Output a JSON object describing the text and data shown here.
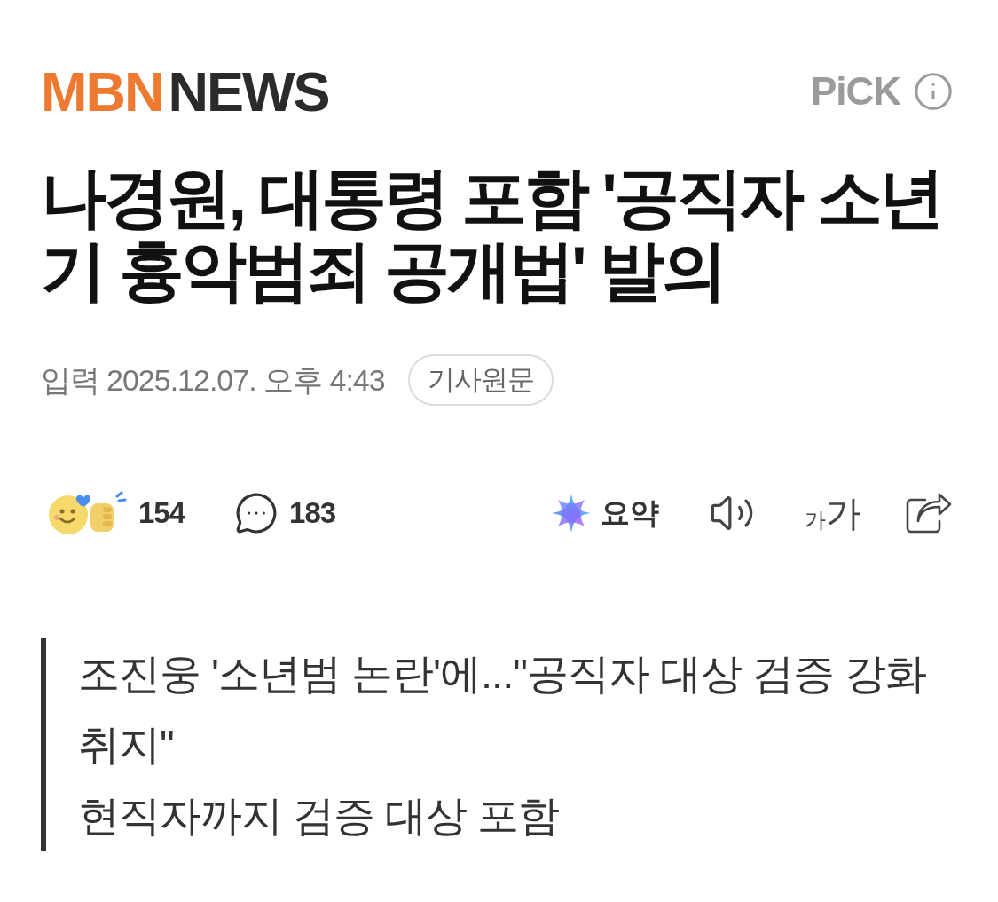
{
  "header": {
    "logo": {
      "brand": "MBN",
      "section": "NEWS"
    },
    "pick_label": "PiCK"
  },
  "headline": "나경원, 대통령 포함 '공직자 소년기 흉악범죄 공개법' 발의",
  "meta": {
    "input_label": "입력",
    "timestamp": "2025.12.07. 오후 4:43",
    "original_article_button": "기사원문"
  },
  "actions": {
    "reactions_count": "154",
    "comments_count": "183",
    "summary_button": "요약",
    "font_size_button": {
      "small": "가",
      "large": "가"
    }
  },
  "summary_lines": [
    "조진웅 '소년범 논란'에...\"공직자 대상 검증 강화 취지\"",
    "현직자까지 검증 대상 포함"
  ]
}
